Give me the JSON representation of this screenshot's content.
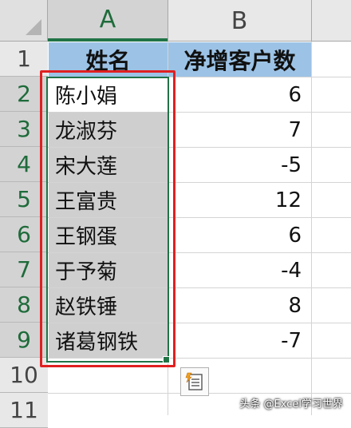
{
  "columns": [
    "A",
    "B"
  ],
  "rows": [
    "1",
    "2",
    "3",
    "4",
    "5",
    "6",
    "7",
    "8",
    "9",
    "10",
    "11"
  ],
  "header": {
    "name": "姓名",
    "net_customers": "净增客户数"
  },
  "records": [
    {
      "name": "陈小娟",
      "value": "6"
    },
    {
      "name": "龙淑芬",
      "value": "7"
    },
    {
      "name": "宋大莲",
      "value": "-5"
    },
    {
      "name": "王富贵",
      "value": "12"
    },
    {
      "name": "王钢蛋",
      "value": "6"
    },
    {
      "name": "于予菊",
      "value": "-4"
    },
    {
      "name": "赵铁锤",
      "value": "8"
    },
    {
      "name": "诸葛钢铁",
      "value": "-7"
    }
  ],
  "watermark": "头条 @Excel学习世界",
  "icons": {
    "quick_analysis": "quick-analysis-icon"
  },
  "colors": {
    "selection": "#217346",
    "header_fill": "#9cc3e6",
    "annotation": "#e02020"
  }
}
